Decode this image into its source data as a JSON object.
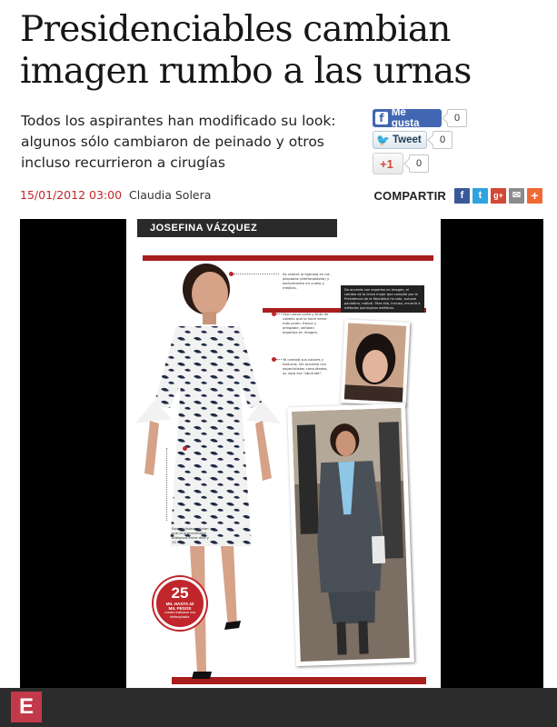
{
  "article": {
    "headline": "Presidenciables cambian imagen rumbo a las urnas",
    "subheadline": "Todos los aspirantes han modificado su look: algunos sólo cambiaron de peinado y otros incluso recurrieron a cirugías",
    "date": "15/01/2012 03:00",
    "author": "Claudia Solera"
  },
  "social": {
    "facebook_label": "Me gusta",
    "facebook_count": "0",
    "twitter_label": "Tweet",
    "twitter_count": "0",
    "gplus_label": "+1",
    "gplus_count": "0"
  },
  "share": {
    "label": "COMPARTIR",
    "buttons": [
      {
        "icon": "facebook-icon",
        "glyph": "f",
        "color": "#3b5998"
      },
      {
        "icon": "twitter-icon",
        "glyph": "t",
        "color": "#2fa3dd"
      },
      {
        "icon": "gplus-icon",
        "glyph": "g+",
        "color": "#d14836"
      },
      {
        "icon": "email-icon",
        "glyph": "✉",
        "color": "#8c8c8c"
      },
      {
        "icon": "plus-icon",
        "glyph": "+",
        "color": "#f06a35"
      }
    ]
  },
  "infographic": {
    "name": "JOSEFINA VÁZQUEZ",
    "annotations": [
      "Se realizó la ligerosa en los párpados (blefaroplastia) y estiramiento en cuello y mejillas.",
      "Usa nuevo corte y tinte de cabello que la hace verse más joven, fresca y amigable, señalan expertos en imagen.",
      "Ya cambió sus colores y texturas. De acuerdo con especialistas consultados, su ropa era \"aburrida\".",
      "Especialistas señalan que la precandidata adelgazó entre diez y 15 kilos."
    ],
    "box_text": "De acuerdo con expertos en imagen, el cambio de la única mujer que compite por la Presidencia de la República ha sido, aunque paulatino, radical. Para ello, incluso, recurrió a métodos quirúrgicos estéticos.",
    "circle_number": "25",
    "circle_line1": "MIL HASTA 40",
    "circle_line2": "MIL PESOS",
    "circle_line3": "cuesta realizarse una blefaroplastia."
  },
  "footer": {
    "logo": "E"
  },
  "colors": {
    "accent_red": "#c0262b",
    "dark_red": "#a81d1d",
    "facebook_blue": "#4267b2"
  }
}
